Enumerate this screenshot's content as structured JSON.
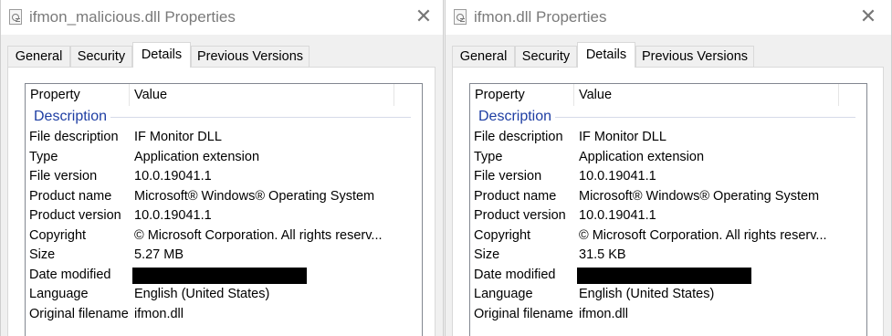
{
  "windows": [
    {
      "title": "ifmon_malicious.dll Properties",
      "tabs": [
        "General",
        "Security",
        "Details",
        "Previous Versions"
      ],
      "active_tab": "Details",
      "columns": {
        "property": "Property",
        "value": "Value"
      },
      "group": "Description",
      "rows": [
        {
          "key": "File description",
          "value": "IF Monitor DLL"
        },
        {
          "key": "Type",
          "value": "Application extension"
        },
        {
          "key": "File version",
          "value": "10.0.19041.1"
        },
        {
          "key": "Product name",
          "value": "Microsoft® Windows® Operating System"
        },
        {
          "key": "Product version",
          "value": "10.0.19041.1"
        },
        {
          "key": "Copyright",
          "value": "© Microsoft Corporation. All rights reserv..."
        },
        {
          "key": "Size",
          "value": "5.27 MB"
        },
        {
          "key": "Date modified",
          "value": ""
        },
        {
          "key": "Language",
          "value": "English (United States)"
        },
        {
          "key": "Original filename",
          "value": "ifmon.dll"
        }
      ]
    },
    {
      "title": "ifmon.dll Properties",
      "tabs": [
        "General",
        "Security",
        "Details",
        "Previous Versions"
      ],
      "active_tab": "Details",
      "columns": {
        "property": "Property",
        "value": "Value"
      },
      "group": "Description",
      "rows": [
        {
          "key": "File description",
          "value": "IF Monitor DLL"
        },
        {
          "key": "Type",
          "value": "Application extension"
        },
        {
          "key": "File version",
          "value": "10.0.19041.1"
        },
        {
          "key": "Product name",
          "value": "Microsoft® Windows® Operating System"
        },
        {
          "key": "Product version",
          "value": "10.0.19041.1"
        },
        {
          "key": "Copyright",
          "value": "© Microsoft Corporation. All rights reserv..."
        },
        {
          "key": "Size",
          "value": "31.5 KB"
        },
        {
          "key": "Date modified",
          "value": ""
        },
        {
          "key": "Language",
          "value": "English (United States)"
        },
        {
          "key": "Original filename",
          "value": "ifmon.dll"
        }
      ]
    }
  ],
  "close_glyph": "✕",
  "colors": {
    "group_title": "#1e3ea3",
    "redaction": "#000000"
  }
}
